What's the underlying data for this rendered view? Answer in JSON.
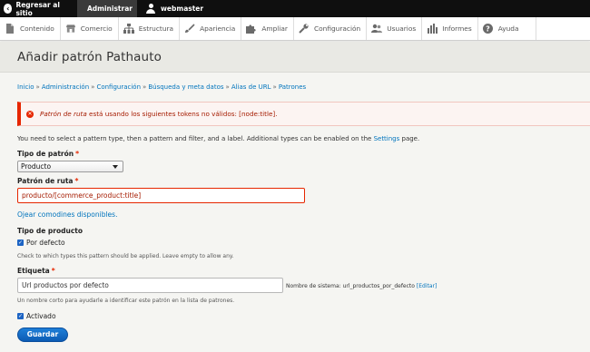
{
  "toolbar": {
    "back_label": "Regresar al sitio",
    "admin_label": "Administrar",
    "user_label": "webmaster"
  },
  "tray": {
    "items": [
      {
        "label": "Contenido",
        "icon": "page-icon"
      },
      {
        "label": "Comercio",
        "icon": "shop-icon"
      },
      {
        "label": "Estructura",
        "icon": "structure-icon"
      },
      {
        "label": "Apariencia",
        "icon": "brush-icon"
      },
      {
        "label": "Ampliar",
        "icon": "puzzle-icon"
      },
      {
        "label": "Configuración",
        "icon": "wrench-icon"
      },
      {
        "label": "Usuarios",
        "icon": "people-icon"
      },
      {
        "label": "Informes",
        "icon": "bar-chart-icon"
      },
      {
        "label": "Ayuda",
        "icon": "help-icon"
      }
    ]
  },
  "page": {
    "title": "Añadir patrón Pathauto"
  },
  "breadcrumb": [
    "Inicio",
    "Administración",
    "Configuración",
    "Búsqueda y meta datos",
    "Alias de URL",
    "Patrones"
  ],
  "breadcrumb_separator": "»",
  "alert": {
    "emphasis": "Patrón de ruta",
    "text": " está usando los siguientes tokens no válidos: [node:title]."
  },
  "intro": {
    "text_before": "You need to select a pattern type, then a pattern and filter, and a label. Additional types can be enabled on the ",
    "link": "Settings",
    "text_after": " page."
  },
  "form": {
    "pattern_type_label": "Tipo de patrón",
    "pattern_type_value": "Producto",
    "path_pattern_label": "Patrón de ruta",
    "path_pattern_value": "producto/[commerce_product:title]",
    "browse_tokens_link": "Ojear comodines disponibles.",
    "product_type_label": "Tipo de producto",
    "default_checkbox_label": "Por defecto",
    "product_type_help": "Check to which types this pattern should be applied. Leave empty to allow any.",
    "label_label": "Etiqueta",
    "label_value": "Url productos por defecto",
    "machine_name_prefix": "Nombre de sistema: url_productos_por_defecto",
    "machine_name_edit": "[Editar]",
    "label_help": "Un nombre corto para ayudarle a identificar este patrón en la lista de patrones.",
    "enabled_label": "Activado",
    "required_marker": "*",
    "save_button": "Guardar"
  },
  "colors": {
    "accent": "#0074bd",
    "error": "#e62600",
    "button": "#1466c4"
  }
}
